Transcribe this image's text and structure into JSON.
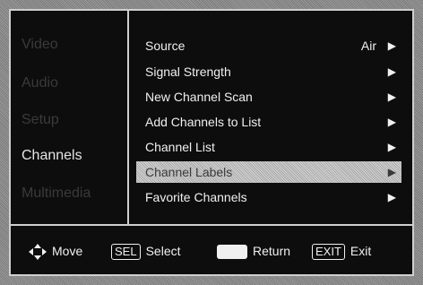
{
  "menu": {
    "categories": [
      {
        "label": "Video"
      },
      {
        "label": "Audio"
      },
      {
        "label": "Setup"
      },
      {
        "label": "Channels"
      },
      {
        "label": "Multimedia"
      }
    ],
    "active_category": "Channels",
    "items": [
      {
        "label": "Source",
        "value": "Air",
        "arrow": "▶"
      },
      {
        "label": "Signal Strength",
        "arrow": "▶"
      },
      {
        "label": "New Channel Scan",
        "arrow": "▶"
      },
      {
        "label": "Add Channels to List",
        "arrow": "▶"
      },
      {
        "label": "Channel List",
        "arrow": "▶"
      },
      {
        "label": "Channel Labels",
        "arrow": "▶"
      },
      {
        "label": "Favorite Channels",
        "arrow": "▶"
      }
    ],
    "selected_item": "Channel Labels"
  },
  "footer": {
    "move_label": "Move",
    "select_key": "SEL",
    "select_label": "Select",
    "return_label": "Return",
    "exit_key": "EXIT",
    "exit_label": "Exit"
  },
  "colors": {
    "panel_bg": "#0d0d0d",
    "border": "#cfcfcf",
    "text": "#f0f0f0",
    "inactive_text": "#3a3a3a",
    "highlight": "#bdbdbd"
  },
  "icons": {
    "move": "four-way-arrow-icon",
    "return": "return-key-icon",
    "submenu": "right-triangle-icon"
  }
}
